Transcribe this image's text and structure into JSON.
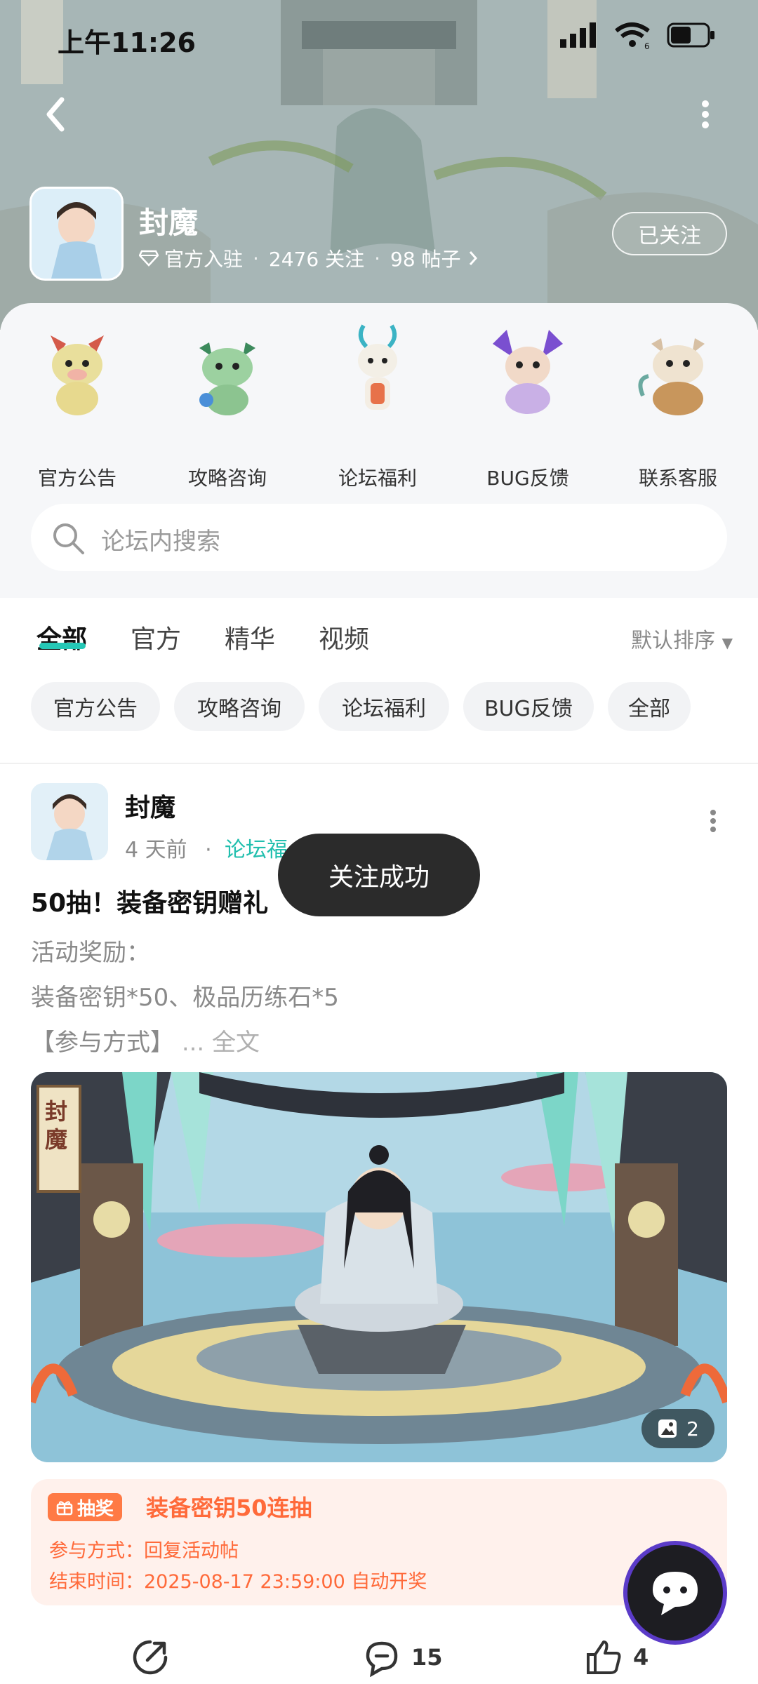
{
  "status_bar": {
    "time": "上午11:26",
    "wifi_badge": "6"
  },
  "header": {
    "game_name": "封魔",
    "official_label": "官方入驻",
    "followers": "2476 关注",
    "posts": "98 帖子",
    "follow_button": "已关注"
  },
  "shortcuts": [
    {
      "label": "官方公告"
    },
    {
      "label": "攻略咨询"
    },
    {
      "label": "论坛福利"
    },
    {
      "label": "BUG反馈"
    },
    {
      "label": "联系客服"
    }
  ],
  "search": {
    "placeholder": "论坛内搜索"
  },
  "tabs": [
    {
      "label": "全部",
      "active": true
    },
    {
      "label": "官方"
    },
    {
      "label": "精华"
    },
    {
      "label": "视频"
    }
  ],
  "sort": {
    "label": "默认排序"
  },
  "chips": [
    "官方公告",
    "攻略咨询",
    "论坛福利",
    "BUG反馈",
    "全部"
  ],
  "post": {
    "author": "封魔",
    "time": "4 天前",
    "board": "论坛福",
    "title": "50抽！装备密钥赠礼",
    "lines": [
      "活动奖励：",
      "装备密钥*50、极品历练石*5",
      "【参与方式】"
    ],
    "more_label": "... 全文",
    "image_count": "2",
    "image_seal": "封魔",
    "lottery": {
      "tag": "抽奖",
      "title": "装备密钥50连抽",
      "method": "参与方式：回复活动帖",
      "end_time": "结束时间：2025-08-17 23:59:00 自动开奖"
    },
    "comments": "15",
    "likes": "4"
  },
  "toast": {
    "text": "关注成功"
  },
  "colors": {
    "accent": "#25c8b6",
    "lottery": "#ff6a3a",
    "toast_bg": "#2b2b2b"
  }
}
